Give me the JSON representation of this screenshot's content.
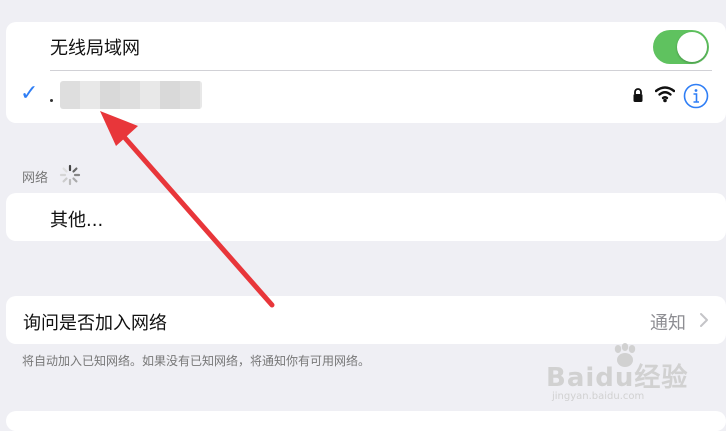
{
  "wlan": {
    "label": "无线局域网",
    "enabled": true,
    "toggle_color": "#5fc25f"
  },
  "current_network": {
    "check_icon": "checkmark-icon",
    "check_color": "#2f7ef5",
    "status_icons": [
      "lock-icon",
      "wifi-icon",
      "info-icon"
    ]
  },
  "networks_section": {
    "label": "网络",
    "loading_icon": "spinner-icon"
  },
  "other": {
    "label": "其他..."
  },
  "ask_to_join": {
    "label": "询问是否加入网络",
    "value": "通知",
    "footnote": "将自动加入已知网络。如果没有已知网络，将通知你有可用网络。"
  },
  "watermark": {
    "text": "Baidu经验",
    "url": "jingyan.baidu.com"
  },
  "accent_colors": {
    "blue": "#2f7ef5",
    "annotation_red": "#e8363a"
  }
}
